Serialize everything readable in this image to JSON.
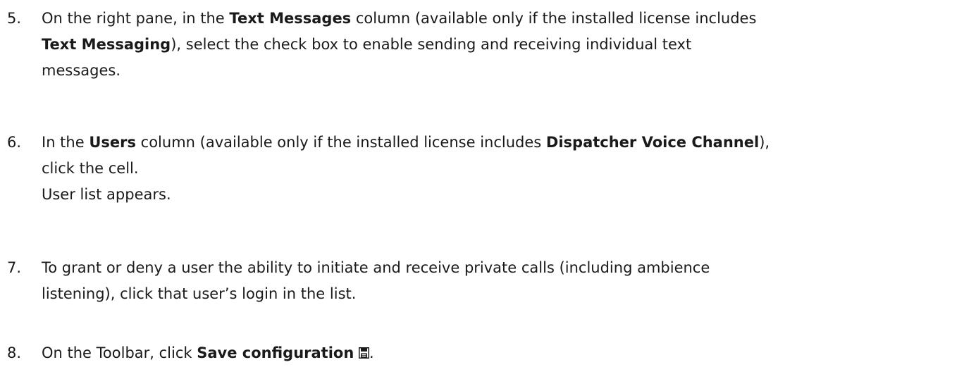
{
  "steps": [
    {
      "number": "5.",
      "lines": [
        [
          "On the right pane, in the ",
          "Text Messages",
          " column (available only if the installed license includes"
        ],
        [
          "",
          "Text Messaging",
          "), select the check box to enable sending and receiving individual text"
        ],
        [
          "messages."
        ]
      ]
    },
    {
      "number": "6.",
      "lines": [
        [
          "In the ",
          "Users",
          " column (available only if the installed license includes ",
          "Dispatcher Voice Channel",
          "),"
        ],
        [
          "click the cell."
        ],
        [
          "User list appears."
        ]
      ]
    },
    {
      "number": "7.",
      "lines": [
        [
          "To grant or deny a user the ability to initiate and receive private calls (including ambience"
        ],
        [
          "listening), click that user’s login in the list."
        ]
      ]
    },
    {
      "number": "8.",
      "lines": [
        [
          "On the Toolbar, click ",
          "Save configuration",
          " ",
          "."
        ]
      ],
      "icon": "save-icon"
    }
  ]
}
